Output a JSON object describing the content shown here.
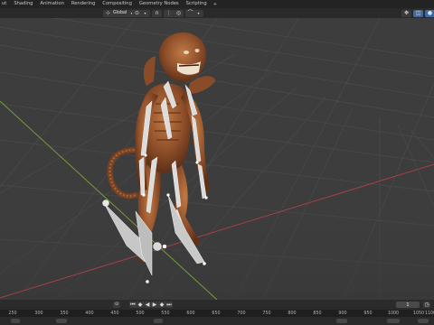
{
  "workspace_tabs": [
    {
      "label": "ut"
    },
    {
      "label": "Shading"
    },
    {
      "label": "Animation"
    },
    {
      "label": "Rendering"
    },
    {
      "label": "Compositing"
    },
    {
      "label": "Geometry Nodes"
    },
    {
      "label": "Scripting"
    }
  ],
  "add_tab_label": "+",
  "header": {
    "orientation_value": "Global"
  },
  "timeline": {
    "current_frame": "1"
  },
  "ruler_labels": [
    "250",
    "300",
    "350",
    "400",
    "450",
    "500",
    "550",
    "600",
    "650",
    "700",
    "750",
    "800",
    "850",
    "900",
    "950",
    "1000",
    "1050",
    "1100"
  ],
  "colors": {
    "x_axis": "#b04048",
    "y_axis": "#7aa339",
    "bone": "#d8d8d8",
    "creature_skin": "#9a5a32",
    "grid": "#4a4a4a",
    "background": "#3d3d3d"
  },
  "icons": {
    "orientation": "axes-icon",
    "pivot": "pivot-icon",
    "snap": "magnet-icon",
    "proportional": "proportional-icon",
    "gizmo": "gizmo-icon",
    "overlay": "overlay-icon",
    "shading": "sphere-icon"
  }
}
